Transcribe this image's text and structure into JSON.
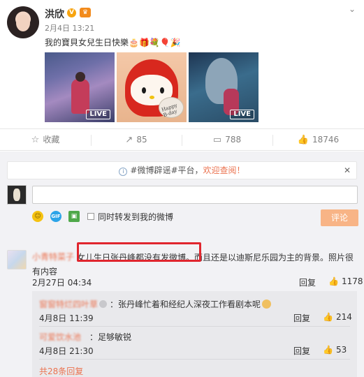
{
  "post": {
    "author": "洪欣",
    "vip_badge": "V",
    "time": "2月4日 13:21",
    "text": "我的寶貝女兒生日快樂🎂🎁💐🎈🎉",
    "more_icon": "chevron-down-icon",
    "photos": [
      {
        "badge": "LIVE"
      },
      {
        "plate_text": "Happy B-day"
      },
      {
        "badge": "LIVE"
      }
    ]
  },
  "actions": {
    "favorite": "收藏",
    "repost": "85",
    "comment": "788",
    "like": "18746"
  },
  "notice": {
    "prefix": "#微博辟谣#平台，",
    "highlight": "欢迎查阅！",
    "close": "✕"
  },
  "composer": {
    "placeholder": "",
    "forward_label": "同时转发到我的微博",
    "submit": "评论"
  },
  "comment": {
    "username": "小青特菜子",
    "body": "女儿生日张丹峰都没有发微博。而且还是以迪斯尼乐园为主的背景。照片很有内容",
    "time": "2月27日 04:34",
    "reply": "回复",
    "likes": "1178"
  },
  "subcomments": [
    {
      "username": "窗窗特烂四叶草",
      "text": "：张丹峰忙着和经纪人深夜工作看剧本呢",
      "time": "4月8日 11:39",
      "reply": "回复",
      "likes": "214"
    },
    {
      "username": "可爱饮水池",
      "text": "：足够敏锐",
      "time": "4月8日 21:30",
      "reply": "回复",
      "likes": "53"
    }
  ],
  "more_replies": "共28条回复",
  "colors": {
    "accent": "#eb7350",
    "highlight_box": "#e0262e",
    "button": "#f8b486"
  }
}
